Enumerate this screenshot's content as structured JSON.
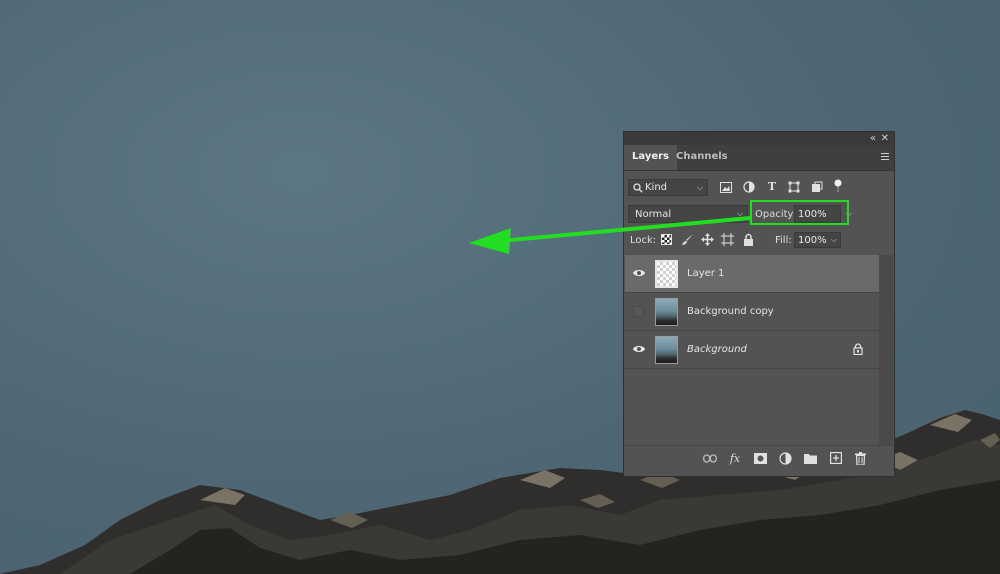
{
  "panel": {
    "tabs": [
      {
        "label": "Layers",
        "active": true
      },
      {
        "label": "Channels",
        "active": false
      }
    ],
    "filter": {
      "label": "Kind"
    },
    "blend_mode": {
      "value": "Normal"
    },
    "opacity": {
      "label": "Opacity:",
      "value": "100%"
    },
    "lock": {
      "label": "Lock:"
    },
    "fill": {
      "label": "Fill:",
      "value": "100%"
    },
    "layers": [
      {
        "name": "Layer 1",
        "visible": true,
        "selected": true,
        "thumbnail": "transparent",
        "locked": false,
        "italic": false
      },
      {
        "name": "Background copy",
        "visible": false,
        "selected": false,
        "thumbnail": "photo",
        "locked": false,
        "italic": false
      },
      {
        "name": "Background",
        "visible": true,
        "selected": false,
        "thumbnail": "photo",
        "locked": true,
        "italic": true
      }
    ]
  },
  "annotation": {
    "highlight_color": "#22dd22",
    "arrow_color": "#22dd22"
  },
  "icons": [
    "collapse-icon",
    "close-icon",
    "panel-menu-icon",
    "search-icon",
    "pixel-filter-icon",
    "adjustment-filter-icon",
    "type-filter-icon",
    "shape-filter-icon",
    "smart-object-filter-icon",
    "filter-toggle-icon",
    "lock-transparent-icon",
    "lock-paint-icon",
    "lock-move-icon",
    "lock-artboard-icon",
    "lock-all-icon",
    "eye-icon",
    "lock-icon",
    "link-icon",
    "fx-icon",
    "mask-icon",
    "adjustment-layer-icon",
    "group-icon",
    "new-layer-icon",
    "trash-icon"
  ]
}
